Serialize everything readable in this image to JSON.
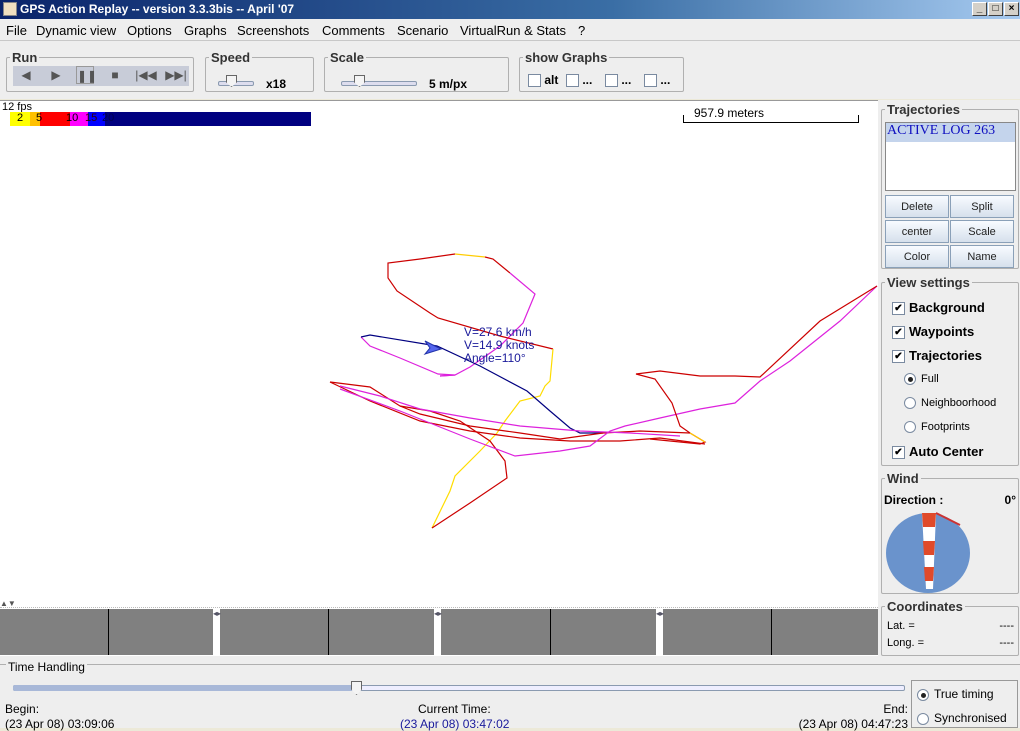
{
  "window": {
    "title": "GPS Action Replay -- version 3.3.3bis -- April '07"
  },
  "menu": [
    "File",
    "Dynamic view",
    "Options",
    "Graphs",
    "Screenshots",
    "Comments",
    "Scenario",
    "VirtualRun & Stats",
    "?"
  ],
  "run": {
    "label": "Run"
  },
  "speed": {
    "label": "Speed",
    "value": "x18",
    "slider_fraction": 0.3
  },
  "scale": {
    "label": "Scale",
    "value": "5 m/px",
    "slider_fraction": 0.2
  },
  "graphs": {
    "label": "show Graphs",
    "items": [
      "alt",
      "...",
      "...",
      "..."
    ]
  },
  "map": {
    "fps": "12 fps",
    "legend_ticks": [
      "2",
      "5",
      "10",
      "15",
      "20"
    ],
    "legend_colors": [
      "#ffff00",
      "#ffc000",
      "#ff0000",
      "#ff00ff",
      "#0000ff",
      "#000080"
    ],
    "scale_bar": "957.9 meters",
    "speed_kmh": "V=27.6 km/h",
    "speed_knots": "V=14.9 knots",
    "angle": "Angle=110°"
  },
  "trajectories": {
    "label": "Trajectories",
    "items": [
      "ACTIVE LOG 263"
    ],
    "buttons": [
      "Delete",
      "Split",
      "center",
      "Scale",
      "Color",
      "Name"
    ]
  },
  "view_settings": {
    "label": "View settings",
    "background": "Background",
    "waypoints": "Waypoints",
    "trajectories": "Trajectories",
    "modes": [
      "Full",
      "Neighboorhood",
      "Footprints"
    ],
    "selected_mode": "Full",
    "auto_center": "Auto Center"
  },
  "wind": {
    "label": "Wind",
    "direction_label": "Direction :",
    "direction_value": "0°"
  },
  "coordinates": {
    "label": "Coordinates",
    "lat_label": "Lat. =",
    "lat_value": "----",
    "long_label": "Long. =",
    "long_value": "----"
  },
  "time": {
    "label": "Time Handling",
    "begin_label": "Begin:",
    "begin_value": "(23 Apr 08) 03:09:06",
    "current_label": "Current Time:",
    "current_value": "(23 Apr 08) 03:47:02",
    "end_label": "End:",
    "end_value": "(23 Apr 08) 04:47:23",
    "progress_fraction": 0.25,
    "true_timing": "True timing",
    "synchronised": "Synchronised",
    "selected": "True timing"
  }
}
